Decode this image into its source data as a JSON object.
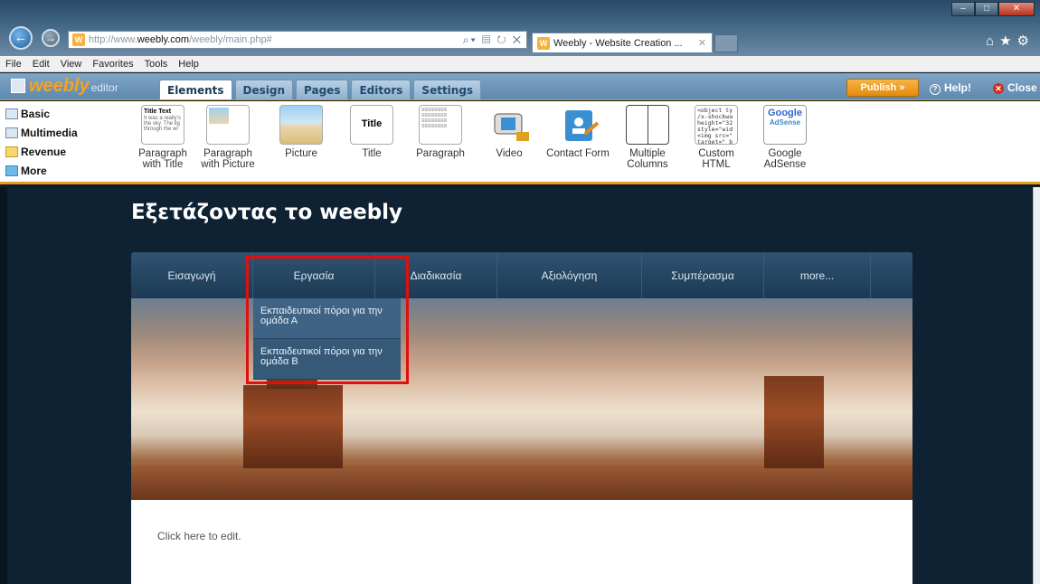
{
  "browser": {
    "url_prefix": "http://www.",
    "url_domain": "weebly.com",
    "url_path": "/weebly/main.php#",
    "tab_title": "Weebly - Website Creation ...",
    "menu": [
      "File",
      "Edit",
      "View",
      "Favorites",
      "Tools",
      "Help"
    ]
  },
  "editor": {
    "logo_text": "weebly",
    "logo_sub": "editor",
    "tabs": [
      "Elements",
      "Design",
      "Pages",
      "Editors",
      "Settings"
    ],
    "active_tab": "Elements",
    "publish_label": "Publish »",
    "help_label": "Help!",
    "close_label": "Close"
  },
  "categories": [
    "Basic",
    "Multimedia",
    "Revenue",
    "More"
  ],
  "elements": [
    {
      "label": "Paragraph with Title",
      "icon": "paragraph-with-title-icon"
    },
    {
      "label": "Paragraph with Picture",
      "icon": "paragraph-with-picture-icon"
    },
    {
      "label": "Picture",
      "icon": "picture-icon"
    },
    {
      "label": "Title",
      "icon": "title-icon"
    },
    {
      "label": "Paragraph",
      "icon": "paragraph-icon"
    },
    {
      "label": "Video",
      "icon": "video-icon"
    },
    {
      "label": "Contact Form",
      "icon": "contact-form-icon"
    },
    {
      "label": "Multiple Columns",
      "icon": "multiple-columns-icon"
    },
    {
      "label": "Custom HTML",
      "icon": "custom-html-icon"
    },
    {
      "label": "Google AdSense",
      "icon": "google-adsense-icon"
    }
  ],
  "thumbs": {
    "title_text": "Title Text",
    "snippet": "It was a really's the sky. The lig through the wi",
    "code": "<object ty /x-shockwa height=\"32 style=\"wid <img src=\" target=\"_b",
    "google": "Google",
    "adsense": "AdSense"
  },
  "site": {
    "title": "Εξετάζοντας το weebly",
    "nav": [
      "Εισαγωγή",
      "Εργασία",
      "Διαδικασία",
      "Αξιολόγηση",
      "Συμπέρασμα",
      "more..."
    ],
    "dropdown": [
      "Εκπαιδευτικοί πόροι για την ομάδα Α",
      "Εκπαιδευτικοί πόροι για την ομάδα Β"
    ],
    "click_to_edit": "Click here to edit."
  },
  "colors": {
    "accent_orange": "#f8a21c",
    "header_blue": "#6f96bb",
    "site_bg": "#0f2233",
    "highlight_red": "#e01010"
  }
}
